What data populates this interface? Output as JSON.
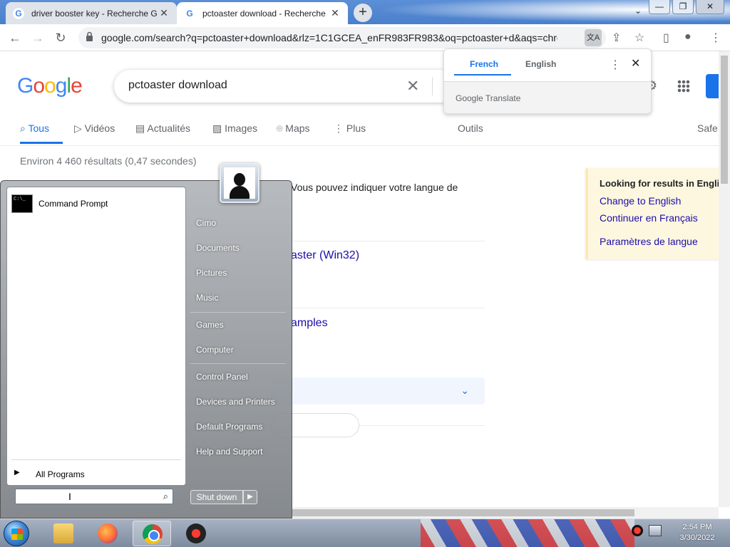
{
  "browser": {
    "tabs": [
      {
        "title": "driver booster key - Recherche G",
        "state": "inactive"
      },
      {
        "title": "pctoaster download - Recherche",
        "state": "active"
      }
    ],
    "url": "google.com/search?q=pctoaster+download&rlz=1C1GCEA_enFR983FR983&oq=pctoaster+d&aqs=chrome..."
  },
  "google": {
    "logo": "Google",
    "query": "pctoaster download",
    "nav": {
      "tous": "Tous",
      "videos": "Vidéos",
      "actualites": "Actualités",
      "images": "Images",
      "maps": "Maps",
      "plus": "Plus",
      "outils": "Outils",
      "safe": "Safe"
    },
    "stats": "Environ 4 460 résultats (0,47 secondes)",
    "lang_note": "Vous pouvez indiquer votre langue de",
    "results": [
      {
        "title": "aster (Win32)"
      },
      {
        "title": "amples"
      }
    ]
  },
  "translate_popup": {
    "lang_from": "French",
    "lang_to": "English",
    "brand": "Google Translate"
  },
  "lang_panel": {
    "heading": "Looking for results in Engli",
    "links": [
      "Change to English",
      "Continuer en Français",
      "Paramètres de langue"
    ]
  },
  "start_menu": {
    "pinned": [
      {
        "label": "Command Prompt"
      }
    ],
    "all_programs": "All Programs",
    "right_items": [
      "Cimo",
      "Documents",
      "Pictures",
      "Music",
      "Games",
      "Computer",
      "Control Panel",
      "Devices and Printers",
      "Default Programs",
      "Help and Support"
    ],
    "shutdown": "Shut down"
  },
  "taskbar": {
    "apps": [
      "file-explorer",
      "firefox",
      "chrome",
      "driver-booster"
    ],
    "time": "2:54 PM",
    "date": "3/30/2022"
  }
}
